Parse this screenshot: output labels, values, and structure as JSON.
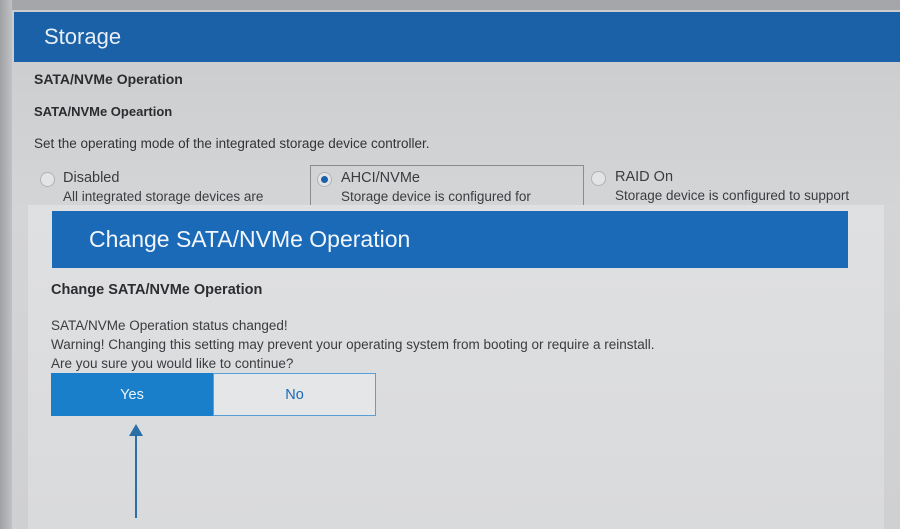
{
  "storage": {
    "title": "Storage",
    "section_label": "SATA/NVMe Operation",
    "sub_label": "SATA/NVMe Opeartion",
    "description": "Set the operating mode of the integrated storage device controller.",
    "options": [
      {
        "label": "Disabled",
        "desc": "All integrated storage devices are",
        "selected": false
      },
      {
        "label": "AHCI/NVMe",
        "desc": "Storage device is configured for",
        "selected": true
      },
      {
        "label": "RAID On",
        "desc": "Storage device is configured to support",
        "selected": false
      }
    ]
  },
  "dialog": {
    "title": "Change SATA/NVMe Operation",
    "subtitle": "Change SATA/NVMe Operation",
    "line1": "SATA/NVMe Operation status changed!",
    "line2": "Warning! Changing this setting may prevent your operating system from booting or require a reinstall.",
    "line3": "Are you sure you would like to continue?",
    "yes_label": "Yes",
    "no_label": "No"
  },
  "colors": {
    "header_blue": "#1a61a8",
    "dialog_blue": "#1a6ab8",
    "yes_button": "#1a7fcb"
  }
}
